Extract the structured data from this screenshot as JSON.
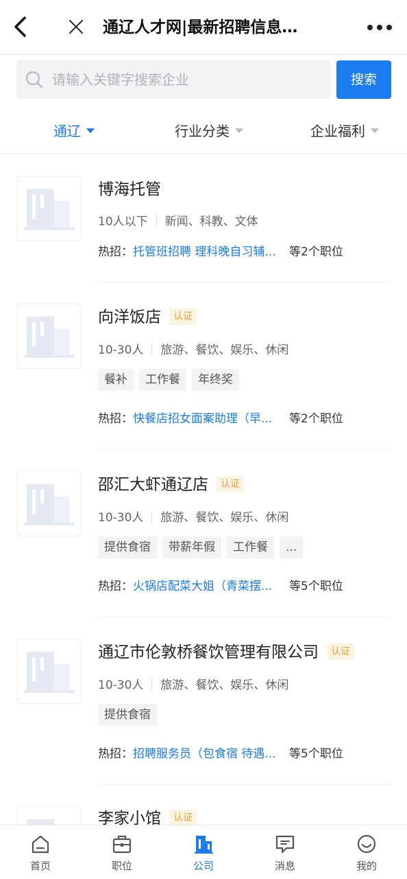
{
  "header": {
    "title": "通辽人才网|最新招聘信息…"
  },
  "search": {
    "placeholder": "请输入关键字搜索企业",
    "value": "",
    "button_label": "搜索"
  },
  "filters": [
    {
      "label": "通辽",
      "active": true
    },
    {
      "label": "行业分类",
      "active": false
    },
    {
      "label": "企业福利",
      "active": false
    }
  ],
  "companies": [
    {
      "name": "博海托管",
      "verified_label": "",
      "size": "10人以下",
      "industry": "新闻、科教、文体",
      "tags": [],
      "hot_prefix": "热招：",
      "hot_jobs": "托管班招聘 理科晚自习辅...",
      "job_count": "等2个职位"
    },
    {
      "name": "向洋饭店",
      "verified_label": "认证",
      "size": "10-30人",
      "industry": "旅游、餐饮、娱乐、休闲",
      "tags": [
        "餐补",
        "工作餐",
        "年终奖"
      ],
      "hot_prefix": "热招：",
      "hot_jobs": "快餐店招女面案助理（早...",
      "job_count": "等2个职位"
    },
    {
      "name": "邵汇大虾通辽店",
      "verified_label": "认证",
      "size": "10-30人",
      "industry": "旅游、餐饮、娱乐、休闲",
      "tags": [
        "提供食宿",
        "带薪年假",
        "工作餐",
        "..."
      ],
      "hot_prefix": "热招：",
      "hot_jobs": "火锅店配菜大姐（青菜摆...",
      "job_count": "等5个职位"
    },
    {
      "name": "通辽市伦敦桥餐饮管理有限公司",
      "verified_label": "认证",
      "size": "10-30人",
      "industry": "旅游、餐饮、娱乐、休闲",
      "tags": [
        "提供食宿"
      ],
      "hot_prefix": "热招：",
      "hot_jobs": "招聘服务员（包食宿 待遇...",
      "job_count": "等5个职位"
    },
    {
      "name": "李家小馆",
      "verified_label": "认证",
      "size": "",
      "industry": "",
      "tags": [],
      "hot_prefix": "",
      "hot_jobs": "",
      "job_count": ""
    }
  ],
  "bottom_nav": [
    {
      "label": "首页",
      "icon": "home-icon",
      "active": false
    },
    {
      "label": "职位",
      "icon": "briefcase-icon",
      "active": false
    },
    {
      "label": "公司",
      "icon": "building-icon",
      "active": true
    },
    {
      "label": "消息",
      "icon": "message-icon",
      "active": false
    },
    {
      "label": "我的",
      "icon": "smiley-icon",
      "active": false
    }
  ],
  "colors": {
    "accent": "#1a7cf0",
    "badge_text": "#e8a23a",
    "badge_bg": "#fdf3e3",
    "tag_bg": "#f2f3f5"
  }
}
